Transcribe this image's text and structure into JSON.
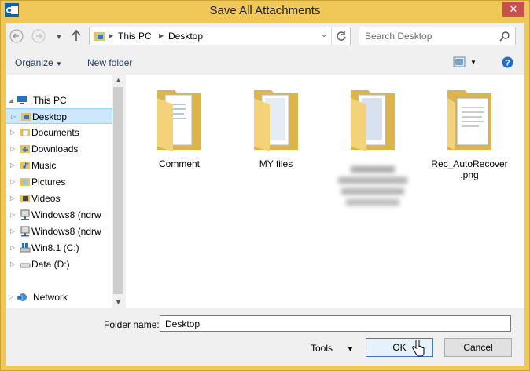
{
  "window": {
    "title": "Save All Attachments",
    "close_glyph": "✕"
  },
  "address": {
    "root_label": "This PC",
    "current_label": "Desktop"
  },
  "search": {
    "placeholder": "Search Desktop"
  },
  "toolbar": {
    "organize_label": "Organize",
    "new_folder_label": "New folder"
  },
  "nav": {
    "items": [
      {
        "label": "This PC",
        "icon": "computer-icon",
        "arrow": "◢"
      },
      {
        "label": "Desktop",
        "icon": "desktop-folder-icon",
        "arrow": "▷",
        "selected": true
      },
      {
        "label": "Documents",
        "icon": "documents-folder-icon",
        "arrow": "▷"
      },
      {
        "label": "Downloads",
        "icon": "downloads-folder-icon",
        "arrow": "▷"
      },
      {
        "label": "Music",
        "icon": "music-folder-icon",
        "arrow": "▷"
      },
      {
        "label": "Pictures",
        "icon": "pictures-folder-icon",
        "arrow": "▷"
      },
      {
        "label": "Videos",
        "icon": "videos-folder-icon",
        "arrow": "▷"
      },
      {
        "label": "Windows8 (ndrw",
        "icon": "network-drive-icon",
        "arrow": "▷"
      },
      {
        "label": "Windows8 (ndrw",
        "icon": "network-drive-icon",
        "arrow": "▷"
      },
      {
        "label": "Win8.1 (C:)",
        "icon": "windows-drive-icon",
        "arrow": "▷"
      },
      {
        "label": "Data (D:)",
        "icon": "drive-icon",
        "arrow": "▷"
      },
      {
        "label": "Network",
        "icon": "network-icon",
        "arrow": "▷"
      }
    ]
  },
  "files": [
    {
      "name": "Comment"
    },
    {
      "name": "MY files"
    },
    {
      "name": ""
    },
    {
      "name": "Rec_AutoRecover\n.png"
    }
  ],
  "bottom": {
    "folder_name_label": "Folder name:",
    "folder_name_value": "Desktop",
    "tools_label": "Tools",
    "ok_label": "OK",
    "cancel_label": "Cancel"
  },
  "colors": {
    "frame": "#f0c85a",
    "close": "#c7504a",
    "selection": "#cce8ff",
    "accent": "#3c7fb1"
  }
}
